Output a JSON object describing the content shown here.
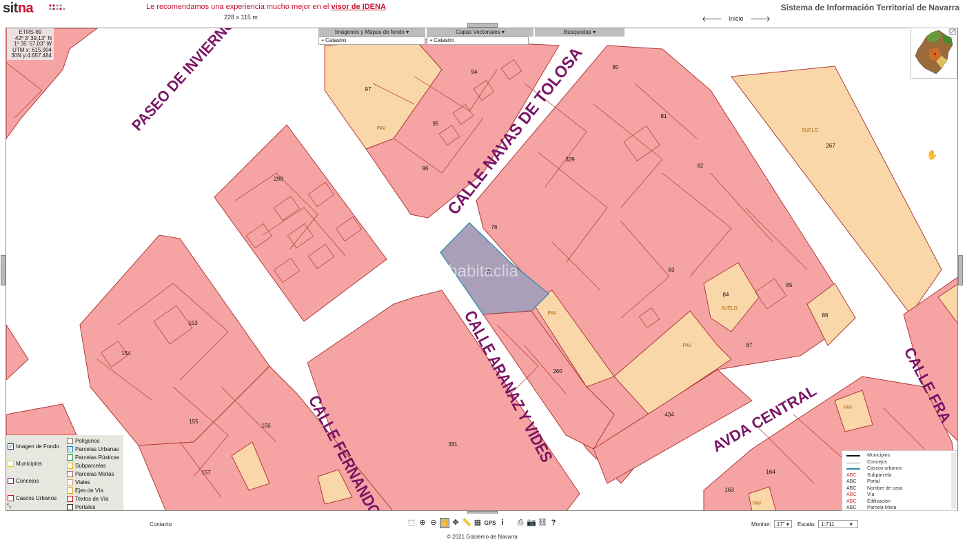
{
  "header": {
    "logo_text_a": "sit",
    "logo_text_b": "na",
    "promo_text": "Le recomendamos una experiencia mucho mejor en el",
    "promo_link": "visor de IDENA",
    "system_title": "Sistema de Información Territorial de Navarra",
    "map_size": "228 x 115 m",
    "nav_home": "Inicio",
    "nav_back": "🡐",
    "nav_forward": "🡒"
  },
  "coords": {
    "datum": "ETRS-89",
    "lat": "42º  3' 39,13\"  N",
    "lon": "1º 35' 57,03\"  W",
    "utm_x": "UTM x:  615.904",
    "utm_y": "30N  y:4.657.484"
  },
  "top_menu": [
    {
      "label": "Imágenes y Mapas de fondo ▾",
      "sub": "• Catastro"
    },
    {
      "label": "Capas Vectoriales ▾",
      "sub": "• Catastro"
    },
    {
      "label": "Búsquedas ▾",
      "sub": ""
    }
  ],
  "layers": {
    "left": [
      {
        "label": "Imagen de Fondo",
        "checked": true,
        "color": "#1a3e8c"
      },
      {
        "label": "Municipios",
        "checked": false,
        "color": "#e8d000"
      },
      {
        "label": "Concejos",
        "checked": false,
        "color": "#7a0a6e"
      },
      {
        "label": "Cascos Urbanos",
        "checked": false,
        "color": "#c8102e"
      }
    ],
    "right": [
      {
        "label": "Polígonos",
        "color": "#8a6a5a"
      },
      {
        "label": "Parcelas Urbanas",
        "color": "#0a7cc8"
      },
      {
        "label": "Parcelas Rústicas",
        "color": "#18a038"
      },
      {
        "label": "Subparcelas",
        "color": "#e8b000"
      },
      {
        "label": "Parcelas Mixtas",
        "color": "#b06060"
      },
      {
        "label": "Viales",
        "color": "#d0a060"
      },
      {
        "label": "Ejes de Vía",
        "color": "#e8a000"
      },
      {
        "label": "Textos de Vía",
        "color": "#c81010"
      },
      {
        "label": "Portales",
        "color": "#333333"
      }
    ]
  },
  "legend": [
    {
      "sym": "",
      "label": "Municipios",
      "line": "#111111"
    },
    {
      "sym": "",
      "label": "Concejos",
      "line": "#999999"
    },
    {
      "sym": "",
      "label": "Cascos urbanos",
      "line": "#2a8aa8"
    },
    {
      "sym": "ABC",
      "label": "Subparcela",
      "color": "#c83030"
    },
    {
      "sym": "ABC",
      "label": "Portal",
      "color": "#333333"
    },
    {
      "sym": "ABC",
      "label": "Nombre de casa",
      "color": "#333333"
    },
    {
      "sym": "ABC",
      "label": "Vía",
      "color": "#c83030"
    },
    {
      "sym": "ABC",
      "label": "Edificación",
      "color": "#c83030"
    },
    {
      "sym": "ABC",
      "label": "Parcela Mixta",
      "color": "#333333"
    }
  ],
  "streets": {
    "paseo": "PASEO DE INVIERNO",
    "navas": "CALLE NAVAS DE TOLOSA",
    "aranaz": "CALLE ARANAZ Y VIDES",
    "fernando": "CALLE FERNANDO",
    "avda": "AVDA CENTRAL",
    "calle_fra": "CALLE FRA"
  },
  "parcel_labels": {
    "p97": "97",
    "p94": "94",
    "p95": "95",
    "p96": "96",
    "p298": "298",
    "p329": "329",
    "p80": "80",
    "p81": "81",
    "p82": "82",
    "p267": "267",
    "p76": "76",
    "p78": "78",
    "p83": "83",
    "p84": "84",
    "p85": "85",
    "p86": "86",
    "p87": "87",
    "p153": "153",
    "p154": "154",
    "p155": "155",
    "p156": "156",
    "p157": "157",
    "p260": "260",
    "p331": "331",
    "p434": "434",
    "p164": "164",
    "p163": "163",
    "suelo1": "SUELO",
    "suelo2": "SUELO",
    "pav1": "PAV",
    "pav2": "PAV",
    "pav3": "PAV",
    "pav4": "PAV",
    "pav5": "PAV",
    "watermark": "habitaclia"
  },
  "footer": {
    "contacto": "Contacto",
    "monitor_label": "Monitor:",
    "monitor_value": "17\" ▾",
    "scale_label": "Escala:",
    "scale_value": "1:711          ▾",
    "copyright": "© 2021 Gobierno de Navarra"
  },
  "colors": {
    "urban_parcel": "#f6a3a3",
    "parcel_stroke": "#b03a3a",
    "pav_parcel": "#fad7a9",
    "selected_parcel": "#a99fb8",
    "street_label": "#7a1565"
  }
}
